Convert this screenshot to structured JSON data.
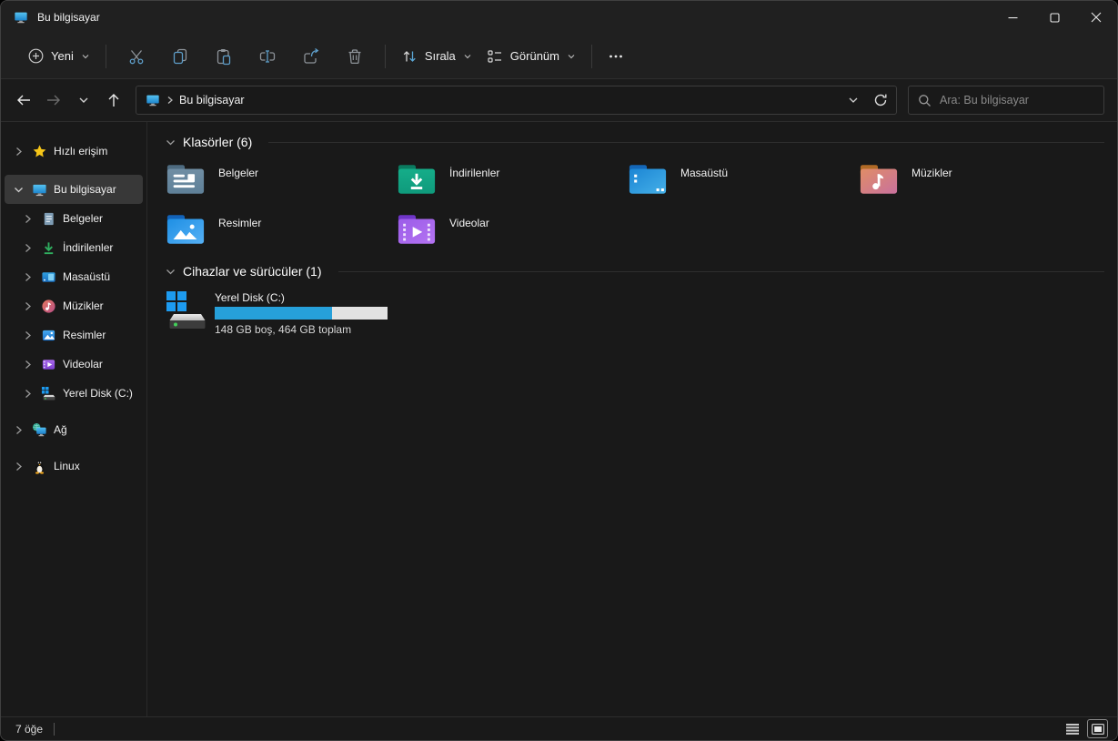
{
  "window": {
    "title": "Bu bilgisayar"
  },
  "toolbar": {
    "new_label": "Yeni",
    "sort_label": "Sırala",
    "view_label": "Görünüm"
  },
  "addressbar": {
    "breadcrumb_root": "Bu bilgisayar",
    "search_placeholder": "Ara: Bu bilgisayar"
  },
  "sidebar": {
    "items": [
      {
        "label": "Hızlı erişim"
      },
      {
        "label": "Bu bilgisayar",
        "selected": true
      },
      {
        "label": "Belgeler"
      },
      {
        "label": "İndirilenler"
      },
      {
        "label": "Masaüstü"
      },
      {
        "label": "Müzikler"
      },
      {
        "label": "Resimler"
      },
      {
        "label": "Videolar"
      },
      {
        "label": "Yerel Disk (C:)"
      },
      {
        "label": "Ağ"
      },
      {
        "label": "Linux"
      }
    ]
  },
  "main": {
    "folders_header": "Klasörler (6)",
    "folders": [
      {
        "label": "Belgeler"
      },
      {
        "label": "İndirilenler"
      },
      {
        "label": "Masaüstü"
      },
      {
        "label": "Müzikler"
      },
      {
        "label": "Resimler"
      },
      {
        "label": "Videolar"
      }
    ],
    "devices_header": "Cihazlar ve sürücüler (1)",
    "drive": {
      "label": "Yerel Disk (C:)",
      "usage_percent": 68,
      "caption": "148 GB boş, 464 GB toplam"
    }
  },
  "statusbar": {
    "items_count": "7 öğe"
  },
  "colors": {
    "accent_blue": "#26a0da",
    "chrome_bg": "#202020",
    "content_bg": "#191919",
    "selection_bg": "#383838"
  }
}
